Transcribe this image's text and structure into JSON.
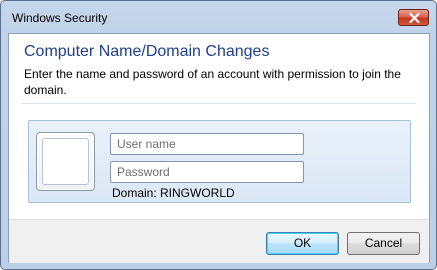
{
  "window": {
    "title": "Windows Security",
    "close_icon": "close-x-icon"
  },
  "dialog": {
    "heading": "Computer Name/Domain Changes",
    "description": "Enter the name and password of an account with permission to join the domain."
  },
  "credentials": {
    "avatar_icon": "user-tile-icon",
    "username": {
      "value": "",
      "placeholder": "User name"
    },
    "password": {
      "value": "",
      "placeholder": "Password"
    },
    "domain_label": "Domain: RINGWORLD"
  },
  "buttons": {
    "ok_label": "OK",
    "cancel_label": "Cancel"
  },
  "colors": {
    "heading": "#1e3f8f",
    "frame": "#c1d3ea",
    "close_button": "#c5371f",
    "default_button_border": "#3c7fb1"
  }
}
